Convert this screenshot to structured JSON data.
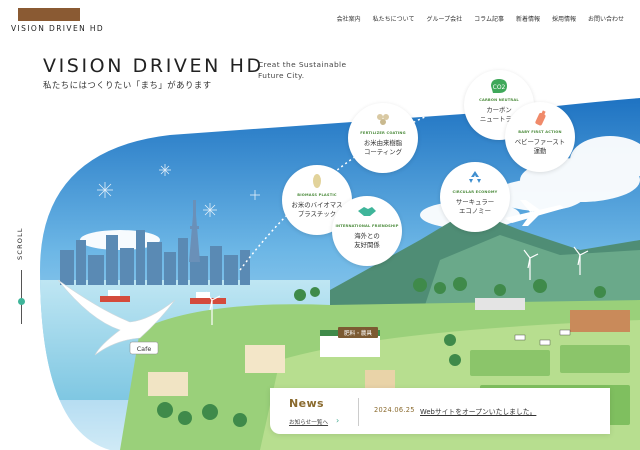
{
  "header": {
    "logo_text": "VISION DRIVEN HD",
    "nav": [
      {
        "label": "会社案内"
      },
      {
        "label": "私たちについて"
      },
      {
        "label": "グループ会社"
      },
      {
        "label": "コラム記事"
      },
      {
        "label": "新着情報"
      },
      {
        "label": "採用情報"
      },
      {
        "label": "お問い合わせ"
      }
    ]
  },
  "hero": {
    "title": "VISION DRIVEN HD",
    "subtitle": "私たちにはつくりたい「まち」があります",
    "tagline": "Creat the Sustainable Future City."
  },
  "scroll": {
    "label": "SCROLL"
  },
  "bubbles": [
    {
      "en": "CARBON NEUTRAL",
      "jp": "カーボン\nニュートラル",
      "icon": "co2-icon"
    },
    {
      "en": "BABY FIRST ACTION",
      "jp": "ベビーファースト\n運動",
      "icon": "baby-bottle-icon"
    },
    {
      "en": "FERTILIZER COATING",
      "jp": "お米由来樹脂\nコーティング",
      "icon": "rice-icon"
    },
    {
      "en": "BIOMASS PLASTIC",
      "jp": "お米のバイオマス\nプラスチック",
      "icon": "rice-grain-icon"
    },
    {
      "en": "INTERNATIONAL FRIENDSHIP",
      "jp": "海外との\n友好関係",
      "icon": "handshake-icon"
    },
    {
      "en": "CIRCULAR ECONOMY",
      "jp": "サーキュラー\nエコノミー",
      "icon": "recycle-icon"
    }
  ],
  "scene": {
    "cafe_sign": "Cafe",
    "farm_sign": "肥料・農具"
  },
  "news": {
    "title": "News",
    "link": "お知らせ一覧へ",
    "date": "2024.06.25",
    "text": "Webサイトをオープンいたしました。"
  },
  "colors": {
    "brand": "#8a5a33",
    "accent": "#3fb59a",
    "news_gold": "#8a6a2e"
  }
}
